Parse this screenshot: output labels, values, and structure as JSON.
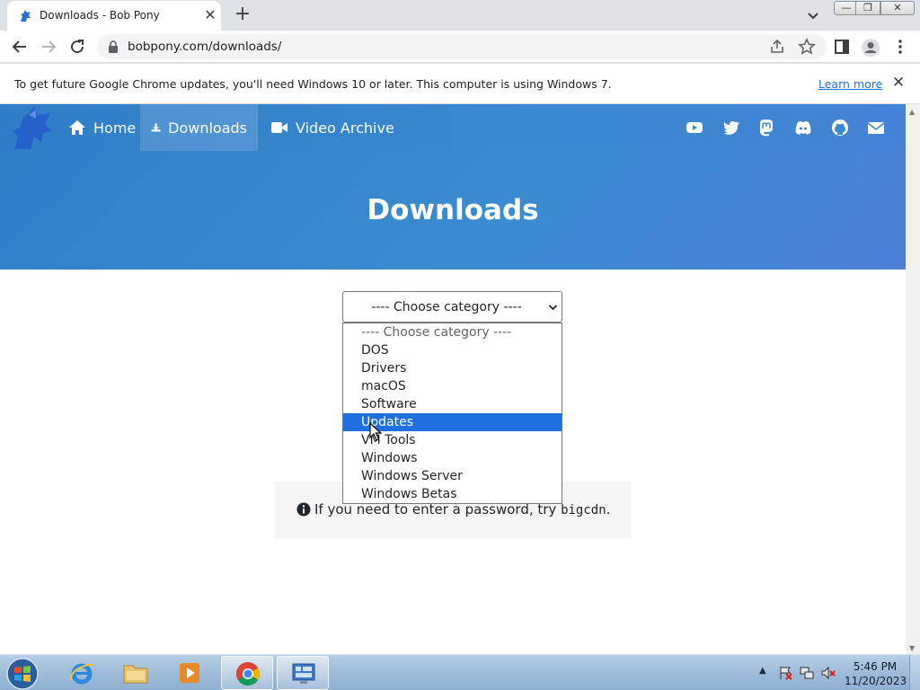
{
  "browser": {
    "tab_title": "Downloads - Bob Pony",
    "tab_close_glyph": "✕",
    "new_tab_glyph": "+",
    "window_minimize": "—",
    "window_maximize": "❐",
    "window_close": "✕",
    "url": "bobpony.com/downloads/"
  },
  "infobar": {
    "message": "To get future Google Chrome updates, you'll need Windows 10 or later. This computer is using Windows 7.",
    "link_label": "Learn more",
    "close_glyph": "✕"
  },
  "site": {
    "nav": [
      {
        "label": "Home",
        "icon": "home-icon"
      },
      {
        "label": "Downloads",
        "icon": "download-icon",
        "active": true
      },
      {
        "label": "Video Archive",
        "icon": "video-camera-icon"
      }
    ],
    "social_icons": [
      "youtube-icon",
      "twitter-icon",
      "mastodon-icon",
      "discord-icon",
      "github-icon",
      "email-icon"
    ],
    "hero_title": "Downloads",
    "select": {
      "current": "---- Choose category ----",
      "options": [
        "---- Choose category ----",
        "DOS",
        "Drivers",
        "macOS",
        "Software",
        "Updates",
        "VM Tools",
        "Windows",
        "Windows Server",
        "Windows Betas"
      ],
      "highlighted": "Updates"
    },
    "notice": {
      "text": "If you need to enter a password, try ",
      "code": "bigcdn",
      "suffix": "."
    },
    "colors": {
      "brand": "#3a89cf",
      "highlight": "#1e6fe0"
    }
  },
  "taskbar": {
    "apps": [
      "start-orb-icon",
      "internet-explorer-icon",
      "file-explorer-icon",
      "media-player-icon",
      "chrome-icon",
      "remote-desktop-icon"
    ],
    "time": "5:46 PM",
    "date": "11/20/2023"
  }
}
